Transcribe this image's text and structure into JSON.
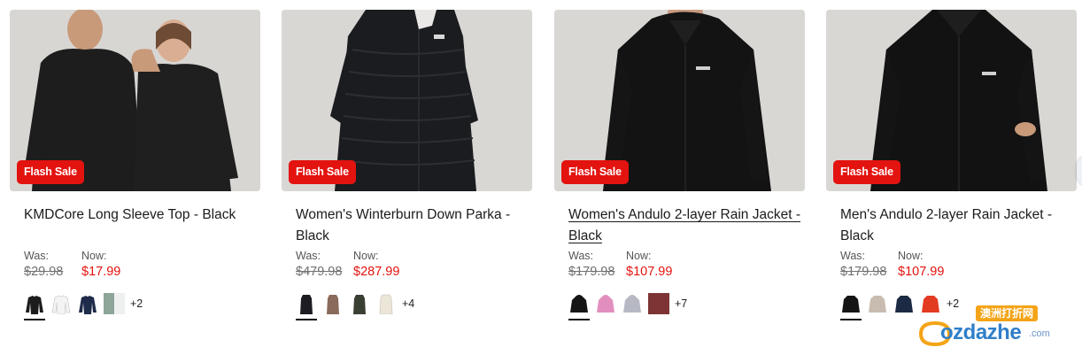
{
  "products": [
    {
      "badge": "Flash Sale",
      "title": "KMDCore Long Sleeve Top - Black",
      "was_label": "Was:",
      "was_price": "$29.98",
      "now_label": "Now:",
      "now_price": "$17.99",
      "more_colours": "+2",
      "swatch_colors": [
        "#1c1c1c",
        "#f4f4f4",
        "#1f2b4a",
        "#8ea59a"
      ]
    },
    {
      "badge": "Flash Sale",
      "title": "Women's Winterburn Down Parka - Black",
      "was_label": "Was:",
      "was_price": "$479.98",
      "now_label": "Now:",
      "now_price": "$287.99",
      "more_colours": "+4",
      "swatch_colors": [
        "#1c1c22",
        "#8a6a5a",
        "#3a3f33",
        "#ebe6d8"
      ]
    },
    {
      "badge": "Flash Sale",
      "title": "Women's Andulo 2-layer Rain Jacket - Black",
      "was_label": "Was:",
      "was_price": "$179.98",
      "now_label": "Now:",
      "now_price": "$107.99",
      "more_colours": "+7",
      "swatch_colors": [
        "#151515",
        "#e28fbf",
        "#b6b8c4",
        "#7e3434"
      ]
    },
    {
      "badge": "Flash Sale",
      "title": "Men's Andulo 2-layer Rain Jacket - Black",
      "was_label": "Was:",
      "was_price": "$179.98",
      "now_label": "Now:",
      "now_price": "$107.99",
      "more_colours": "+2",
      "swatch_colors": [
        "#151515",
        "#c8bcb0",
        "#1d2a44",
        "#e23b22"
      ]
    }
  ],
  "watermark": {
    "cn_text": "澳洲打折网",
    "en_text": "ozdazhe",
    "domain": ".com"
  },
  "colors": {
    "sale_red": "#e3130f",
    "image_bg": "#d9d7d4"
  },
  "icons": [
    "carousel-next-arrow-icon",
    "watermark-logo-icon"
  ]
}
